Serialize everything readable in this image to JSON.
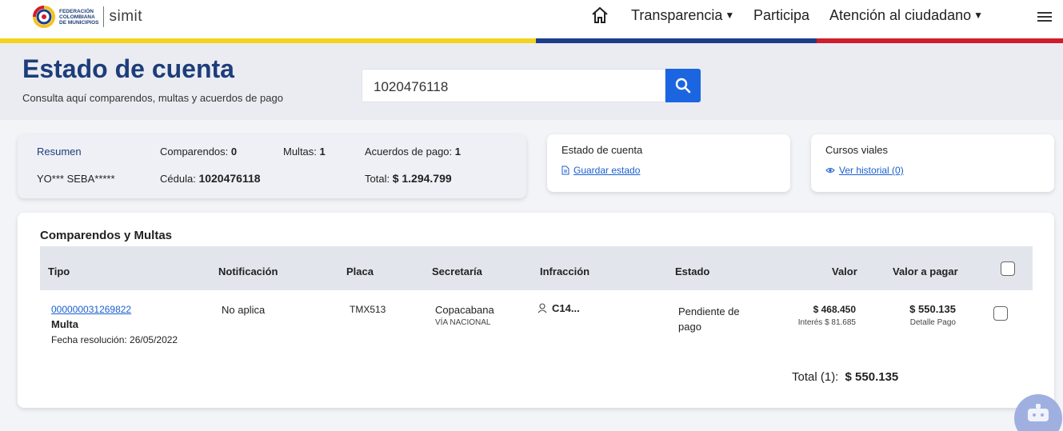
{
  "header": {
    "logo_fed_lines": [
      "FEDERACIÓN",
      "COLOMBIANA",
      "DE MUNICIPIOS"
    ],
    "logo_simit": "simit",
    "nav": {
      "home_icon": "home-icon",
      "transparencia": "Transparencia",
      "participa": "Participa",
      "atencion": "Atención al ciudadano",
      "menu_icon": "hamburger-icon"
    },
    "stripe_colors": [
      "#f4d31c",
      "#1d3d8a",
      "#cf1e2b"
    ]
  },
  "hero": {
    "title": "Estado de cuenta",
    "subtitle": "Consulta aquí comparendos, multas y acuerdos de pago",
    "search_value": "1020476118",
    "search_icon": "search-icon"
  },
  "summary": {
    "title": "Resumen",
    "name": "YO*** SEBA*****",
    "comparendos_label": "Comparendos:",
    "comparendos_value": "0",
    "multas_label": "Multas:",
    "multas_value": "1",
    "acuerdos_label": "Acuerdos de pago:",
    "acuerdos_value": "1",
    "cedula_label": "Cédula:",
    "cedula_value": "1020476118",
    "total_label": "Total:",
    "total_value": "$ 1.294.799"
  },
  "estado_card": {
    "title": "Estado de cuenta",
    "link": "Guardar estado",
    "icon": "document-icon"
  },
  "cursos_card": {
    "title": "Cursos viales",
    "link": "Ver historial (0)",
    "icon": "eye-icon"
  },
  "table": {
    "section_title": "Comparendos y Multas",
    "headers": [
      "Tipo",
      "Notificación",
      "Placa",
      "Secretaría",
      "Infracción",
      "Estado",
      "Valor",
      "Valor a pagar"
    ],
    "rows": [
      {
        "numero": "000000031269822",
        "tipo": "Multa",
        "fecha": "Fecha resolución: 26/05/2022",
        "notificacion": "No aplica",
        "placa": "TMX513",
        "secretaria": "Copacabana",
        "secretaria_sub": "VÍA NACIONAL",
        "infraccion": "C14...",
        "estado": "Pendiente de pago",
        "valor": "$ 468.450",
        "interes": "Interés $ 81.685",
        "valor_pagar": "$ 550.135",
        "detalle": "Detalle Pago"
      }
    ],
    "total_label": "Total (1):",
    "total_value": "$ 550.135"
  },
  "chatbot_icon": "chatbot-icon"
}
